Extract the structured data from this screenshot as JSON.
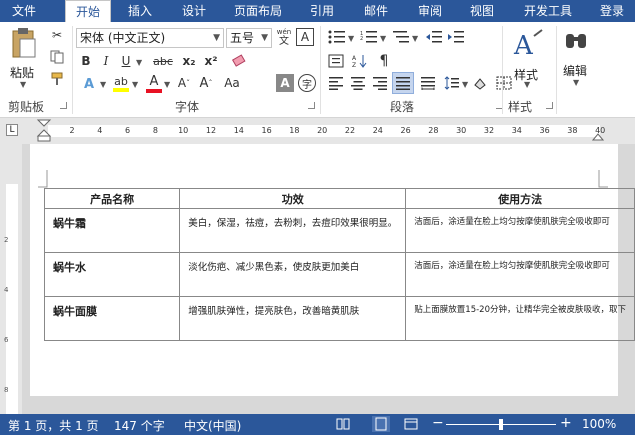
{
  "tabs": [
    "文件",
    "开始",
    "插入",
    "设计",
    "页面布局",
    "引用",
    "邮件",
    "审阅",
    "视图",
    "开发工具",
    "登录"
  ],
  "clipboard": {
    "paste": "粘贴",
    "group": "剪贴板"
  },
  "font": {
    "name": "宋体 (中文正文)",
    "size": "五号",
    "group": "字体",
    "bold": "B",
    "italic": "I",
    "underline": "U",
    "strike": "abc",
    "subscript": "x₂",
    "superscript": "x²",
    "phonetic_top": "wén",
    "phonetic_bottom": "文"
  },
  "paragraph": {
    "group": "段落"
  },
  "styles": {
    "label": "样式",
    "group": "样式"
  },
  "editing": {
    "label": "编辑"
  },
  "ruler": {
    "marks": [
      "2",
      "4",
      "6",
      "8",
      "10",
      "12",
      "14",
      "16",
      "18",
      "20",
      "22",
      "24",
      "26",
      "28",
      "30",
      "32",
      "34",
      "36",
      "38",
      "40"
    ],
    "vmarks": [
      "2",
      "4",
      "6",
      "8"
    ]
  },
  "table": {
    "headers": [
      "产品名称",
      "功效",
      "使用方法"
    ],
    "rows": [
      [
        "蜗牛霜",
        "美白，保湿，祛痘，去粉刺，去痘印效果很明显。",
        "洁面后，涂适量在脸上均匀按摩使肌肤完全吸收即可"
      ],
      [
        "蜗牛水",
        "淡化伤疤、减少黑色素，使皮肤更加美白",
        "洁面后，涂适量在脸上均匀按摩使肌肤完全吸收即可"
      ],
      [
        "蜗牛面膜",
        "增强肌肤弹性，提亮肤色，改善暗黄肌肤",
        "贴上面膜放置15-20分钟，让精华完全被皮肤吸收，取下"
      ]
    ]
  },
  "status": {
    "page": "第 1 页，共 1 页",
    "words": "147 个字",
    "lang": "中文(中国)",
    "zoom": "100%"
  },
  "colors": {
    "accent": "#2b579a",
    "highlight": "#ffff00",
    "font_color": "#e81123"
  }
}
